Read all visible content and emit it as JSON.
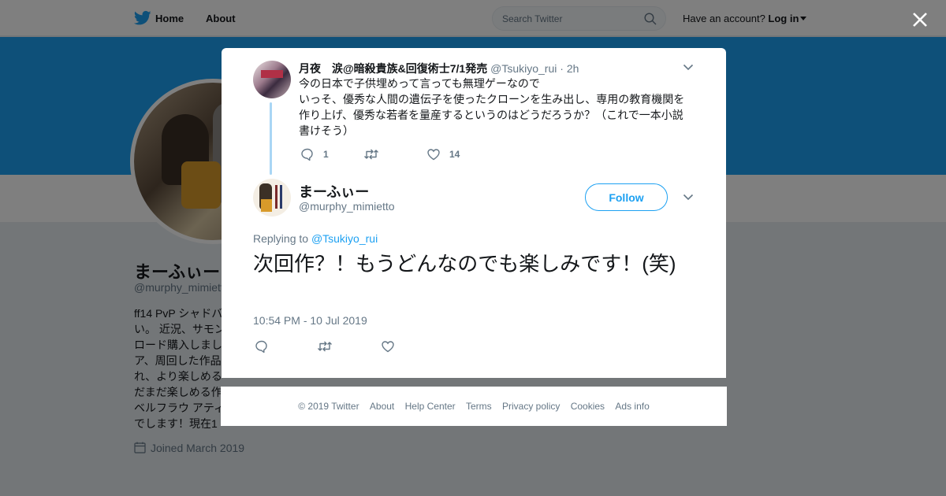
{
  "topbar": {
    "home_label": "Home",
    "about_label": "About",
    "search_placeholder": "Search Twitter",
    "account_prompt": "Have an account?",
    "login_label": "Log in"
  },
  "profile": {
    "name": "まーふぃー",
    "handle": "@murphy_mimietto",
    "bio_lines": [
      "ff14 PvP シャドバ",
      "い。 近況、サモン",
      "ロード購入しまし",
      "ア、周回した作品",
      "れ、より楽しめる",
      "だまだ楽しめる作",
      "ベルフラウ アティ",
      "でします！現在1"
    ],
    "joined": "Joined March 2019"
  },
  "parent_tweet": {
    "name": "月夜　涙@暗殺貴族&回復術士7/1発売",
    "handle": "@Tsukiyo_rui",
    "time": "· 2h",
    "text_lines": [
      "今の日本で子供埋めって言っても無理ゲーなので",
      "いっそ、優秀な人間の遺伝子を使ったクローンを生み出し、専用の教育機関を",
      "作り上げ、優秀な若者を量産するというのはどうだろうか？（これで一本小説",
      "書けそう）"
    ],
    "reply_count": "1",
    "like_count": "14"
  },
  "main_tweet": {
    "name": "まーふぃー",
    "handle": "@murphy_mimietto",
    "follow_label": "Follow",
    "replying_prefix": "Replying to",
    "replying_handle": "@Tsukiyo_rui",
    "text": "次回作？！もうどんなのでも楽しみです！(笑)",
    "timestamp": "10:54 PM - 10 Jul 2019"
  },
  "footer": {
    "links": [
      "© 2019 Twitter",
      "About",
      "Help Center",
      "Terms",
      "Privacy policy",
      "Cookies",
      "Ads info"
    ]
  },
  "colors": {
    "accent": "#1da1f2",
    "muted": "#657786",
    "thread_line": "#a9d6f5"
  }
}
